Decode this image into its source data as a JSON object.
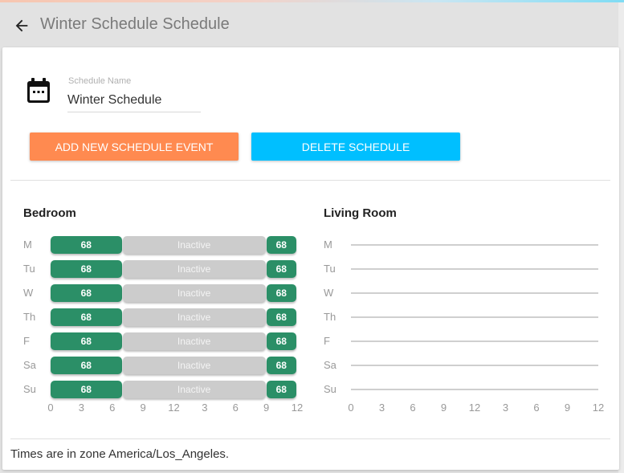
{
  "header": {
    "back_icon": "arrow-left-icon",
    "title": "Winter Schedule Schedule"
  },
  "form": {
    "icon": "calendar-icon",
    "label": "Schedule Name",
    "value": "Winter Schedule"
  },
  "buttons": {
    "add_label": "ADD NEW SCHEDULE EVENT",
    "delete_label": "DELETE SCHEDULE"
  },
  "colors": {
    "add_button": "#ff8a50",
    "delete_button": "#00bfff",
    "active_event": "#2b8f67",
    "inactive_event": "#cccccc"
  },
  "axis_ticks": [
    "0",
    "3",
    "6",
    "9",
    "12",
    "3",
    "6",
    "9",
    "12"
  ],
  "axis_hours": [
    0,
    3,
    6,
    9,
    12,
    15,
    18,
    21,
    24
  ],
  "rooms": [
    {
      "name": "Bedroom",
      "days": [
        {
          "day": "M",
          "events": [
            {
              "start": 0,
              "end": 7,
              "label": "68",
              "type": "active"
            },
            {
              "start": 7,
              "end": 21,
              "label": "Inactive",
              "type": "inactive"
            },
            {
              "start": 21,
              "end": 24,
              "label": "68",
              "type": "active"
            }
          ]
        },
        {
          "day": "Tu",
          "events": [
            {
              "start": 0,
              "end": 7,
              "label": "68",
              "type": "active"
            },
            {
              "start": 7,
              "end": 21,
              "label": "Inactive",
              "type": "inactive"
            },
            {
              "start": 21,
              "end": 24,
              "label": "68",
              "type": "active"
            }
          ]
        },
        {
          "day": "W",
          "events": [
            {
              "start": 0,
              "end": 7,
              "label": "68",
              "type": "active"
            },
            {
              "start": 7,
              "end": 21,
              "label": "Inactive",
              "type": "inactive"
            },
            {
              "start": 21,
              "end": 24,
              "label": "68",
              "type": "active"
            }
          ]
        },
        {
          "day": "Th",
          "events": [
            {
              "start": 0,
              "end": 7,
              "label": "68",
              "type": "active"
            },
            {
              "start": 7,
              "end": 21,
              "label": "Inactive",
              "type": "inactive"
            },
            {
              "start": 21,
              "end": 24,
              "label": "68",
              "type": "active"
            }
          ]
        },
        {
          "day": "F",
          "events": [
            {
              "start": 0,
              "end": 7,
              "label": "68",
              "type": "active"
            },
            {
              "start": 7,
              "end": 21,
              "label": "Inactive",
              "type": "inactive"
            },
            {
              "start": 21,
              "end": 24,
              "label": "68",
              "type": "active"
            }
          ]
        },
        {
          "day": "Sa",
          "events": [
            {
              "start": 0,
              "end": 7,
              "label": "68",
              "type": "active"
            },
            {
              "start": 7,
              "end": 21,
              "label": "Inactive",
              "type": "inactive"
            },
            {
              "start": 21,
              "end": 24,
              "label": "68",
              "type": "active"
            }
          ]
        },
        {
          "day": "Su",
          "events": [
            {
              "start": 0,
              "end": 7,
              "label": "68",
              "type": "active"
            },
            {
              "start": 7,
              "end": 21,
              "label": "Inactive",
              "type": "inactive"
            },
            {
              "start": 21,
              "end": 24,
              "label": "68",
              "type": "active"
            }
          ]
        }
      ]
    },
    {
      "name": "Living Room",
      "days": [
        {
          "day": "M",
          "events": []
        },
        {
          "day": "Tu",
          "events": []
        },
        {
          "day": "W",
          "events": []
        },
        {
          "day": "Th",
          "events": []
        },
        {
          "day": "F",
          "events": []
        },
        {
          "day": "Sa",
          "events": []
        },
        {
          "day": "Su",
          "events": []
        }
      ]
    }
  ],
  "footer": {
    "timezone_note": "Times are in zone America/Los_Angeles."
  }
}
